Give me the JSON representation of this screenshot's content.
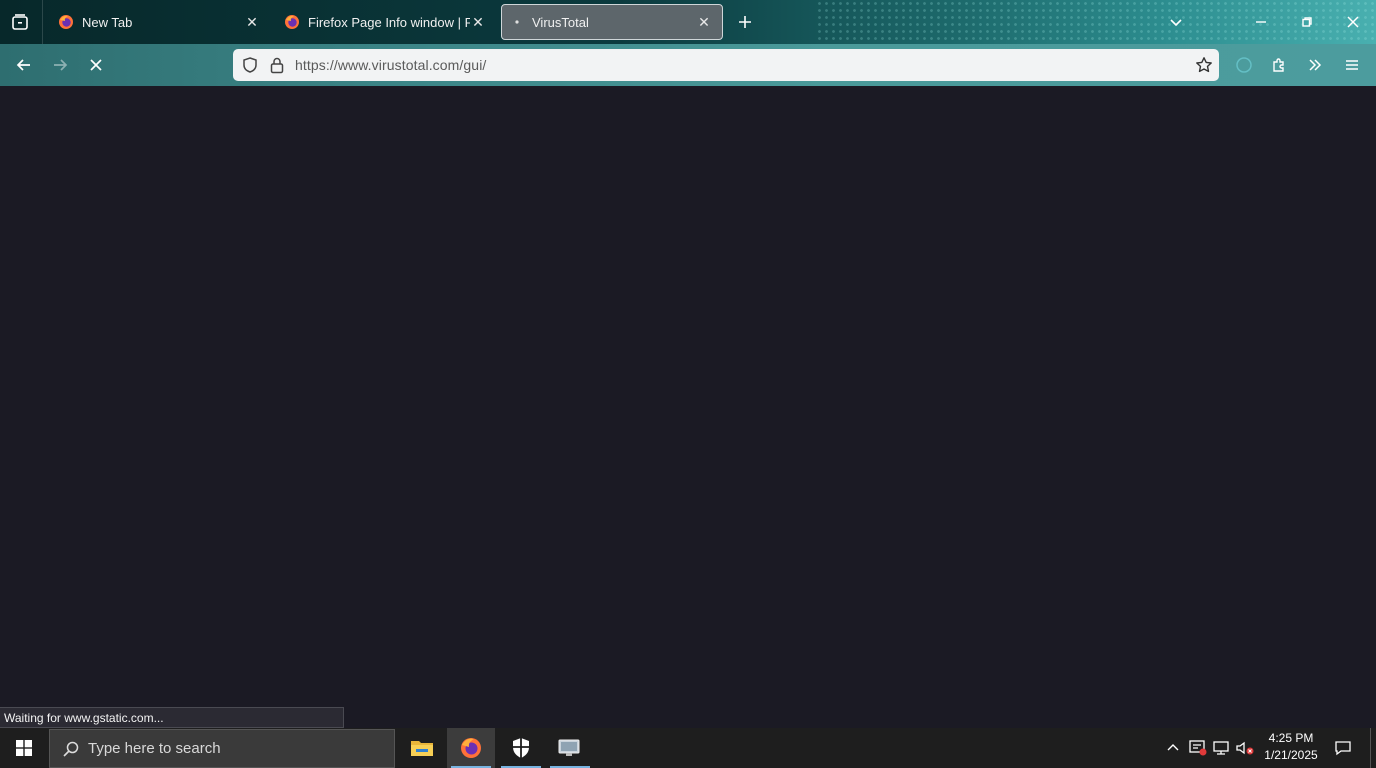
{
  "browser": {
    "tabs": [
      {
        "title": "New Tab",
        "favicon": "firefox-icon"
      },
      {
        "title": "Firefox Page Info window | Firef",
        "favicon": "firefox-icon"
      },
      {
        "title": "VirusTotal",
        "favicon": "loading-dot-icon",
        "active": true
      }
    ],
    "url": "https://www.virustotal.com/gui/",
    "status": "Waiting for www.gstatic.com..."
  },
  "taskbar": {
    "search_placeholder": "Type here to search",
    "apps": [
      "file-explorer-icon",
      "firefox-icon",
      "windows-security-icon",
      "remote-desktop-icon"
    ],
    "time": "4:25 PM",
    "date": "1/21/2025"
  },
  "colors": {
    "content_bg": "#1b1a24",
    "taskbar_bg": "#1e1e1e",
    "active_tab_bg": "#5d666b"
  }
}
